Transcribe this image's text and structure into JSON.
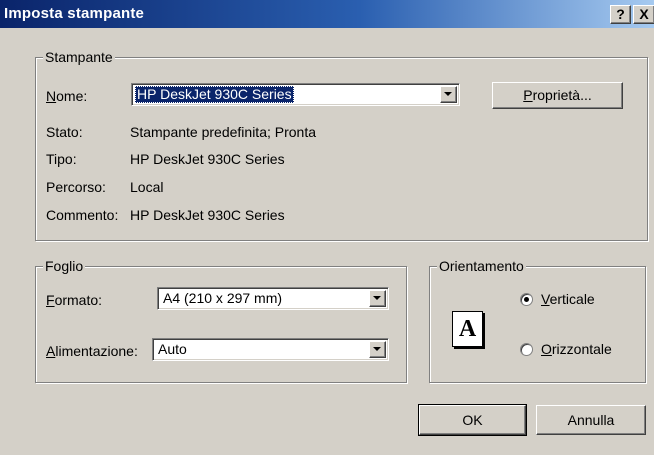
{
  "window": {
    "title": "Imposta stampante",
    "help_label": "?",
    "close_label": "X"
  },
  "printer_group": {
    "legend": "Stampante",
    "name_label_key": "N",
    "name_label_rest": "ome:",
    "name_value": "HP DeskJet 930C Series",
    "properties_key": "P",
    "properties_rest": "roprietà...",
    "status_label": "Stato:",
    "status_value": "Stampante predefinita; Pronta",
    "type_label": "Tipo:",
    "type_value": "HP DeskJet 930C Series",
    "path_label": "Percorso:",
    "path_value": "Local",
    "comment_label": "Commento:",
    "comment_value": "HP DeskJet 930C Series"
  },
  "paper_group": {
    "legend": "Foglio",
    "format_label_key": "F",
    "format_label_rest": "ormato:",
    "format_value": "A4 (210 x 297 mm)",
    "source_label_key": "A",
    "source_label_rest": "limentazione:",
    "source_value": "Auto"
  },
  "orientation_group": {
    "legend": "Orientamento",
    "page_icon_letter": "A",
    "portrait_key": "V",
    "portrait_rest": "erticale",
    "landscape_key": "O",
    "landscape_rest": "rizzontale",
    "selected": "Verticale"
  },
  "buttons": {
    "ok_label": "OK",
    "cancel_label": "Annulla"
  }
}
